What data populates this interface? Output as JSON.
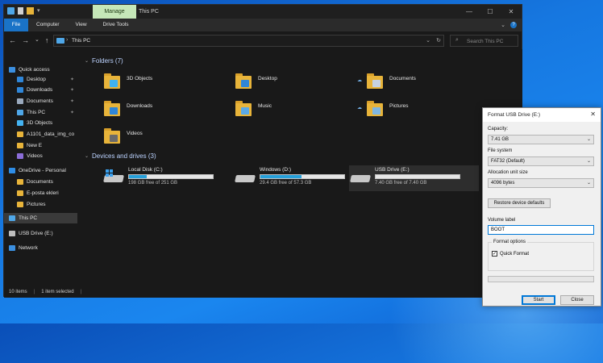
{
  "explorer": {
    "title": "This PC",
    "manage_tab": "Manage",
    "ribbon_tabs": [
      "File",
      "Computer",
      "View",
      "Drive Tools"
    ],
    "address": "This PC",
    "search_placeholder": "Search This PC",
    "status": {
      "items": "10 items",
      "selected": "1 item selected"
    }
  },
  "sidebar": {
    "items": [
      {
        "label": "Quick access",
        "color": "#3b8fe0",
        "pinned": false
      },
      {
        "label": "Desktop",
        "color": "#2f86d8",
        "pinned": true
      },
      {
        "label": "Downloads",
        "color": "#2f86d8",
        "pinned": true
      },
      {
        "label": "Documents",
        "color": "#9aa9bd",
        "pinned": true
      },
      {
        "label": "This PC",
        "color": "#4fa7e8",
        "pinned": true
      },
      {
        "label": "3D Objects",
        "color": "#44b3f2",
        "pinned": false
      },
      {
        "label": "A1101_data_img_co",
        "color": "#e8b43a",
        "pinned": false
      },
      {
        "label": "New E",
        "color": "#e8b43a",
        "pinned": false
      },
      {
        "label": "Videos",
        "color": "#8b6dd8",
        "pinned": false
      },
      {
        "label": "OneDrive - Personal",
        "color": "#2e8de6",
        "pinned": false
      },
      {
        "label": "Documents",
        "color": "#e8b43a",
        "pinned": false
      },
      {
        "label": "E-posta ekleri",
        "color": "#e8b43a",
        "pinned": false
      },
      {
        "label": "Pictures",
        "color": "#e8b43a",
        "pinned": false
      },
      {
        "label": "This PC",
        "color": "#4fa7e8",
        "pinned": false
      },
      {
        "label": "USB Drive (E:)",
        "color": "#bdbdbd",
        "pinned": false
      },
      {
        "label": "Network",
        "color": "#3b8fe0",
        "pinned": false
      }
    ]
  },
  "folders": {
    "header": "Folders (7)",
    "items": [
      {
        "name": "3D Objects",
        "badge": "#3fb2f0",
        "cloud": false
      },
      {
        "name": "Desktop",
        "badge": "#2f86d8",
        "cloud": false
      },
      {
        "name": "Documents",
        "badge": "#c7d3e3",
        "cloud": true
      },
      {
        "name": "Downloads",
        "badge": "#2f86d8",
        "cloud": false
      },
      {
        "name": "Music",
        "badge": "#5aa9e6",
        "cloud": false
      },
      {
        "name": "Pictures",
        "badge": "#7fb6e0",
        "cloud": true
      },
      {
        "name": "Videos",
        "badge": "#6a6a6a",
        "cloud": false
      }
    ]
  },
  "drives": {
    "header": "Devices and drives (3)",
    "items": [
      {
        "name": "Local Disk (C:)",
        "free": "198 GB free of 251 GB",
        "used_fraction": 0.21,
        "windows": true
      },
      {
        "name": "Windows (D:)",
        "free": "29.4 GB free of 57.3 GB",
        "used_fraction": 0.49,
        "windows": false
      },
      {
        "name": "USB Drive (E:)",
        "free": "7.40 GB free of 7.40 GB",
        "used_fraction": 0.0,
        "windows": false
      }
    ]
  },
  "dialog": {
    "title": "Format USB Drive (E:)",
    "capacity_label": "Capacity:",
    "capacity_value": "7.41 GB",
    "fs_label": "File system",
    "fs_value": "FAT32 (Default)",
    "alloc_label": "Allocation unit size",
    "alloc_value": "4096 bytes",
    "restore_button": "Restore device defaults",
    "volume_label": "Volume label",
    "volume_value": "BOOT",
    "options_legend": "Format options",
    "quick_format": "Quick Format",
    "start_button": "Start",
    "close_button": "Close"
  }
}
